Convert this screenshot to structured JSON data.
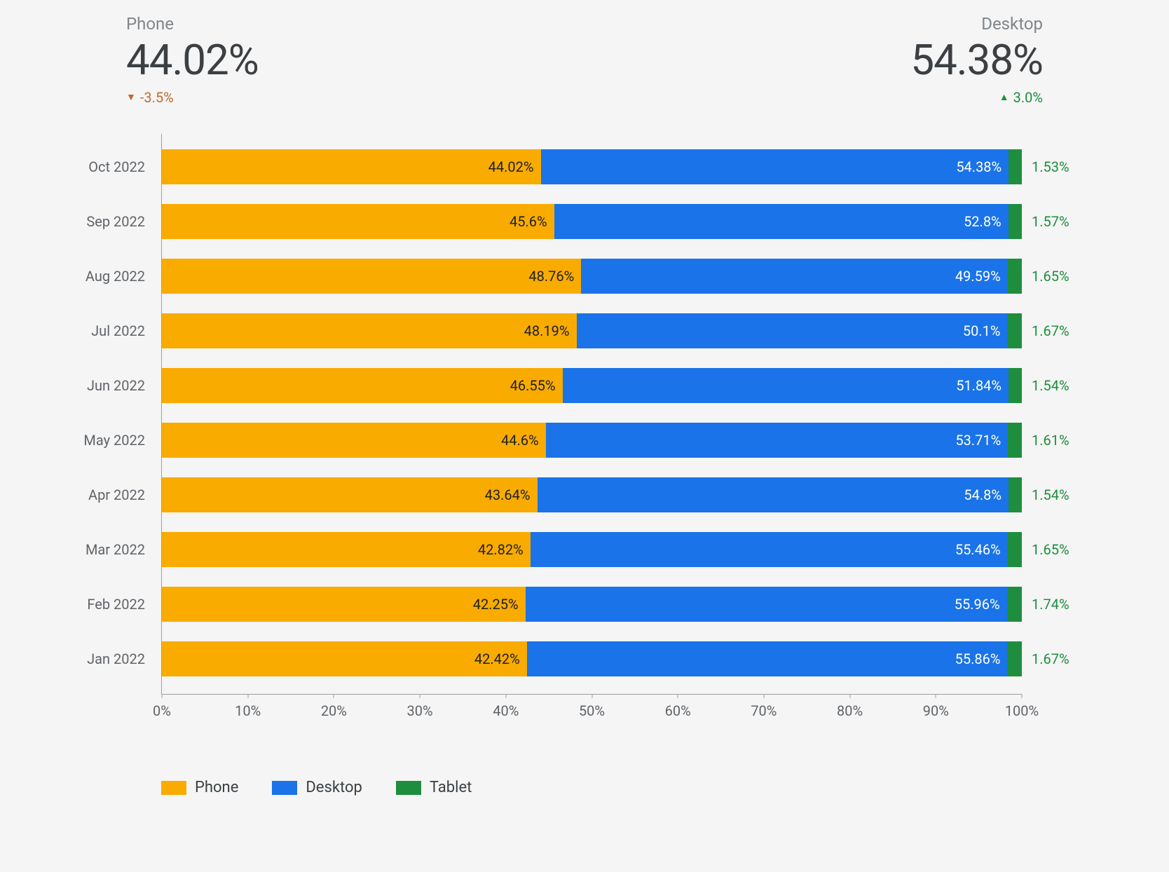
{
  "header": {
    "phone": {
      "label": "Phone",
      "value": "44.02%",
      "delta": "-3.5%",
      "direction": "down"
    },
    "desktop": {
      "label": "Desktop",
      "value": "54.38%",
      "delta": "3.0%",
      "direction": "up"
    }
  },
  "legend": {
    "phone": "Phone",
    "desktop": "Desktop",
    "tablet": "Tablet"
  },
  "axis": {
    "ticks": [
      "0%",
      "10%",
      "20%",
      "30%",
      "40%",
      "50%",
      "60%",
      "70%",
      "80%",
      "90%",
      "100%"
    ]
  },
  "chart_data": {
    "type": "bar",
    "stacked": true,
    "orientation": "horizontal",
    "xlim": [
      0,
      100
    ],
    "xlabel": "",
    "ylabel": "",
    "categories": [
      "Oct 2022",
      "Sep 2022",
      "Aug 2022",
      "Jul 2022",
      "Jun 2022",
      "May 2022",
      "Apr 2022",
      "Mar 2022",
      "Feb 2022",
      "Jan 2022"
    ],
    "series": [
      {
        "name": "Phone",
        "color": "#f9ab00",
        "values": [
          44.02,
          45.6,
          48.76,
          48.19,
          46.55,
          44.6,
          43.64,
          42.82,
          42.25,
          42.42
        ]
      },
      {
        "name": "Desktop",
        "color": "#1a73e8",
        "values": [
          54.38,
          52.8,
          49.59,
          50.1,
          51.84,
          53.71,
          54.8,
          55.46,
          55.96,
          55.86
        ]
      },
      {
        "name": "Tablet",
        "color": "#1e8e3e",
        "values": [
          1.53,
          1.57,
          1.65,
          1.67,
          1.54,
          1.61,
          1.54,
          1.65,
          1.74,
          1.67
        ]
      }
    ],
    "value_labels": {
      "phone": [
        "44.02%",
        "45.6%",
        "48.76%",
        "48.19%",
        "46.55%",
        "44.6%",
        "43.64%",
        "42.82%",
        "42.25%",
        "42.42%"
      ],
      "desktop": [
        "54.38%",
        "52.8%",
        "49.59%",
        "50.1%",
        "51.84%",
        "53.71%",
        "54.8%",
        "55.46%",
        "55.96%",
        "55.86%"
      ],
      "tablet": [
        "1.53%",
        "1.57%",
        "1.65%",
        "1.67%",
        "1.54%",
        "1.61%",
        "1.54%",
        "1.65%",
        "1.74%",
        "1.67%"
      ]
    }
  }
}
